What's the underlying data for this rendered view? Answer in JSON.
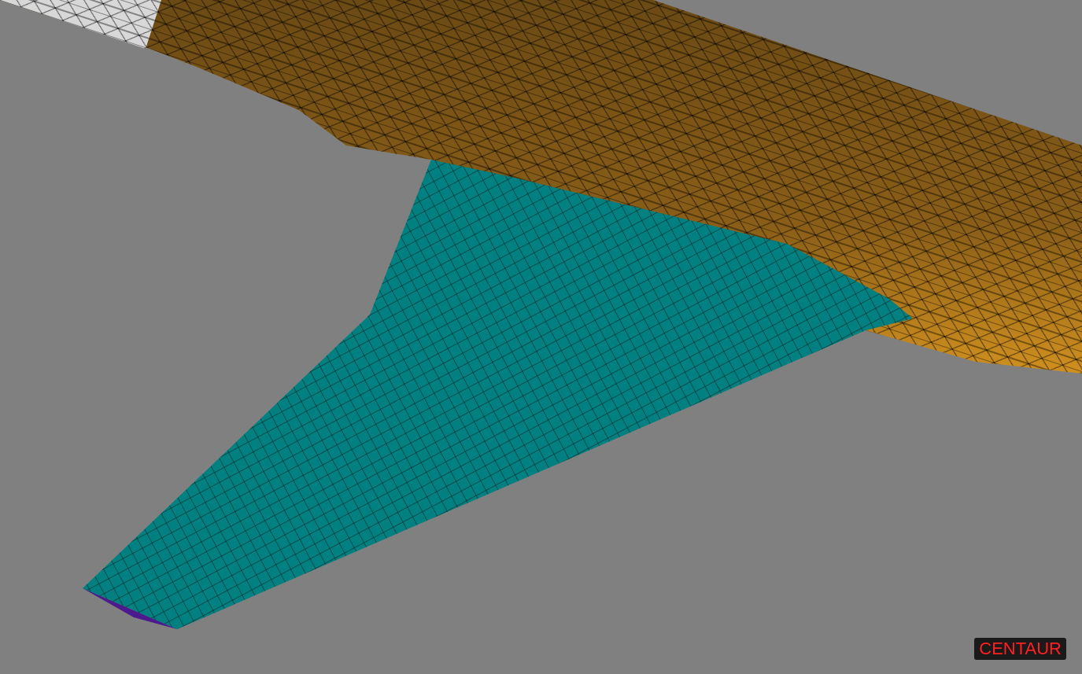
{
  "viewport": {
    "label": "CENTAUR"
  }
}
